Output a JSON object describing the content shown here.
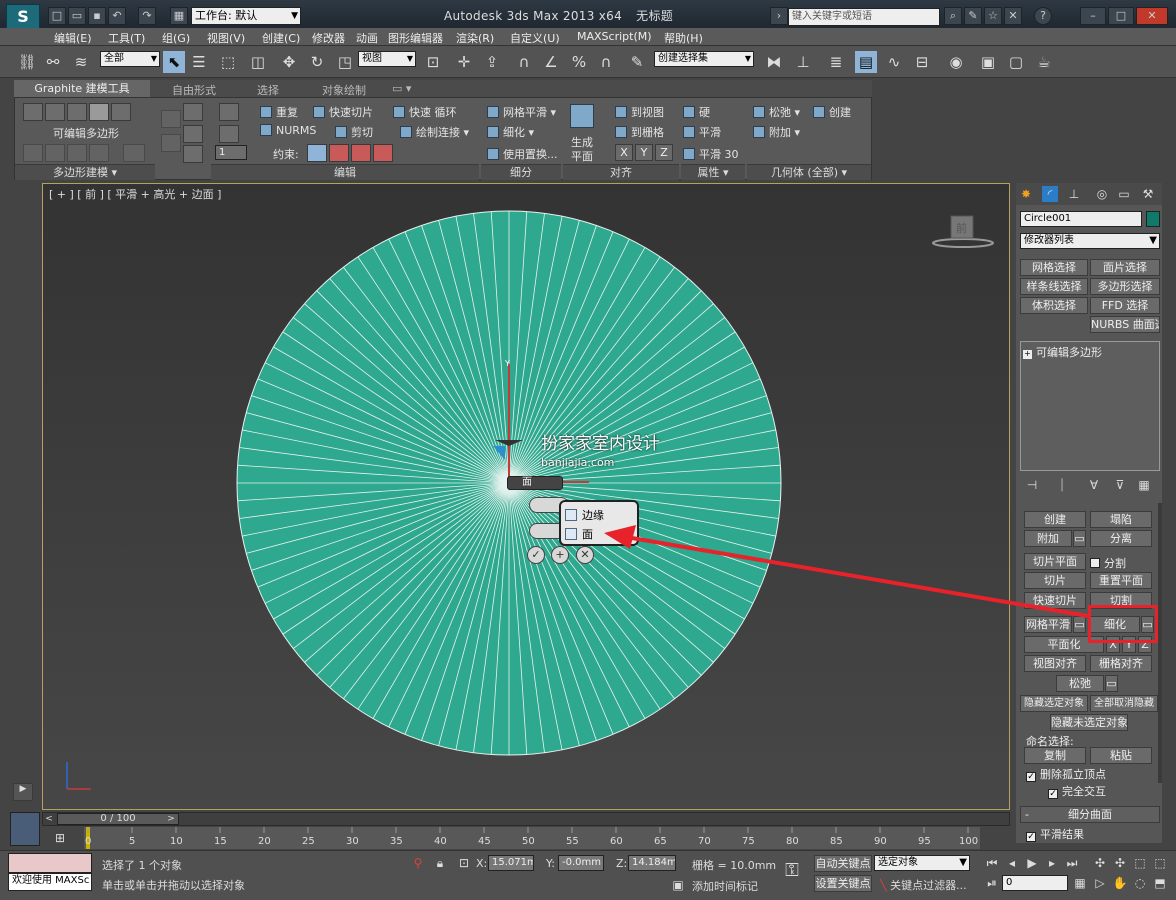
{
  "title_bar": {
    "logo_text": "S",
    "workspace_prefix": "工作台:",
    "workspace_value": "默认",
    "app_title": "Autodesk 3ds Max  2013 x64",
    "doc_title": "无标题",
    "search_placeholder": "键入关键字或短语"
  },
  "menu": [
    "编辑(E)",
    "工具(T)",
    "组(G)",
    "视图(V)",
    "创建(C)",
    "修改器",
    "动画",
    "图形编辑器",
    "渲染(R)",
    "自定义(U)",
    "MAXScript(M)",
    "帮助(H)"
  ],
  "toolbar": {
    "filter_select": "全部",
    "coord_select": "视图",
    "selection_set": "创建选择集"
  },
  "ribbon_tabs": [
    "Graphite 建模工具",
    "自由形式",
    "选择",
    "对象绘制"
  ],
  "ribbon": {
    "poly_label": "可编辑多边形",
    "sec_polymodel": "多边形建模",
    "edit_buttons": [
      "重复",
      "快速切片",
      "快速 循环",
      "NURMS",
      "剪切",
      "绘制连接"
    ],
    "constraint_label": "约束:",
    "spinner_value": "1",
    "sec_edit": "编辑",
    "subdiv_buttons": [
      "网格平滑",
      "细化",
      "使用置换..."
    ],
    "sec_subdiv": "细分",
    "align_generate": "生成",
    "align_plane": "平面",
    "align_buttons": [
      "到视图",
      "到栅格"
    ],
    "xyz": [
      "X",
      "Y",
      "Z"
    ],
    "sec_align": "对齐",
    "prop_buttons": [
      "硬",
      "平滑",
      "平滑 30"
    ],
    "sec_prop": "属性",
    "geom_buttons": [
      "松弛",
      "创建",
      "附加"
    ],
    "sec_geom": "几何体 (全部)"
  },
  "viewport": {
    "label": "[ + ] [ 前 ] [ 平滑 + 高光 + 边面 ]",
    "watermark": "扮家家室内设计",
    "watermark_url": "banjiajia.com",
    "caddy_field": "面",
    "popup_items": [
      "边缘",
      "面"
    ],
    "gizmo_y": "Y",
    "accent_color": "#2ea88e"
  },
  "right_panel": {
    "object_name": "Circle001",
    "object_color": "#0f7a6a",
    "modifier_list": "修改器列表",
    "modifier_buttons": [
      "网格选择",
      "面片选择",
      "样条线选择",
      "多边形选择",
      "体积选择",
      "FFD 选择",
      "NURBS 曲面选择"
    ],
    "stack_item": "可编辑多边形",
    "geom_buttons": [
      "创建",
      "塌陷",
      "附加",
      "分离",
      "切片平面",
      "切片",
      "重置平面",
      "快速切片",
      "切割",
      "网格平滑",
      "细化",
      "平面化",
      "视图对齐",
      "栅格对齐",
      "松弛",
      "隐藏选定对象",
      "全部取消隐藏",
      "隐藏未选定对象"
    ],
    "split_label": "分割",
    "xyz": [
      "X",
      "Y",
      "Z"
    ],
    "named_sel": "命名选择:",
    "copy": "复制",
    "paste": "粘贴",
    "delete_isolated": "删除孤立顶点",
    "full_interact": "完全交互",
    "rollout_subdiv": "细分曲面",
    "smooth_result": "平滑结果"
  },
  "timeline": {
    "frame": "0 / 100",
    "ticks": [
      "0",
      "5",
      "10",
      "15",
      "20",
      "25",
      "30",
      "35",
      "40",
      "45",
      "50",
      "55",
      "60",
      "65",
      "70",
      "75",
      "80",
      "85",
      "90",
      "95",
      "100"
    ]
  },
  "status": {
    "welcome": "欢迎使用 MAXSc",
    "selected": "选择了 1 个对象",
    "prompt": "单击或单击并拖动以选择对象",
    "x_label": "X:",
    "x": "15.071mm",
    "y_label": "Y:",
    "y": "-0.0mm",
    "z_label": "Z:",
    "z": "14.184mm",
    "grid": "栅格 = 10.0mm",
    "add_tag": "添加时间标记",
    "autokey": "自动关键点",
    "setkey": "设置关键点",
    "key_select": "选定对象",
    "key_filter": "关键点过滤器...",
    "frame_value": "0"
  }
}
